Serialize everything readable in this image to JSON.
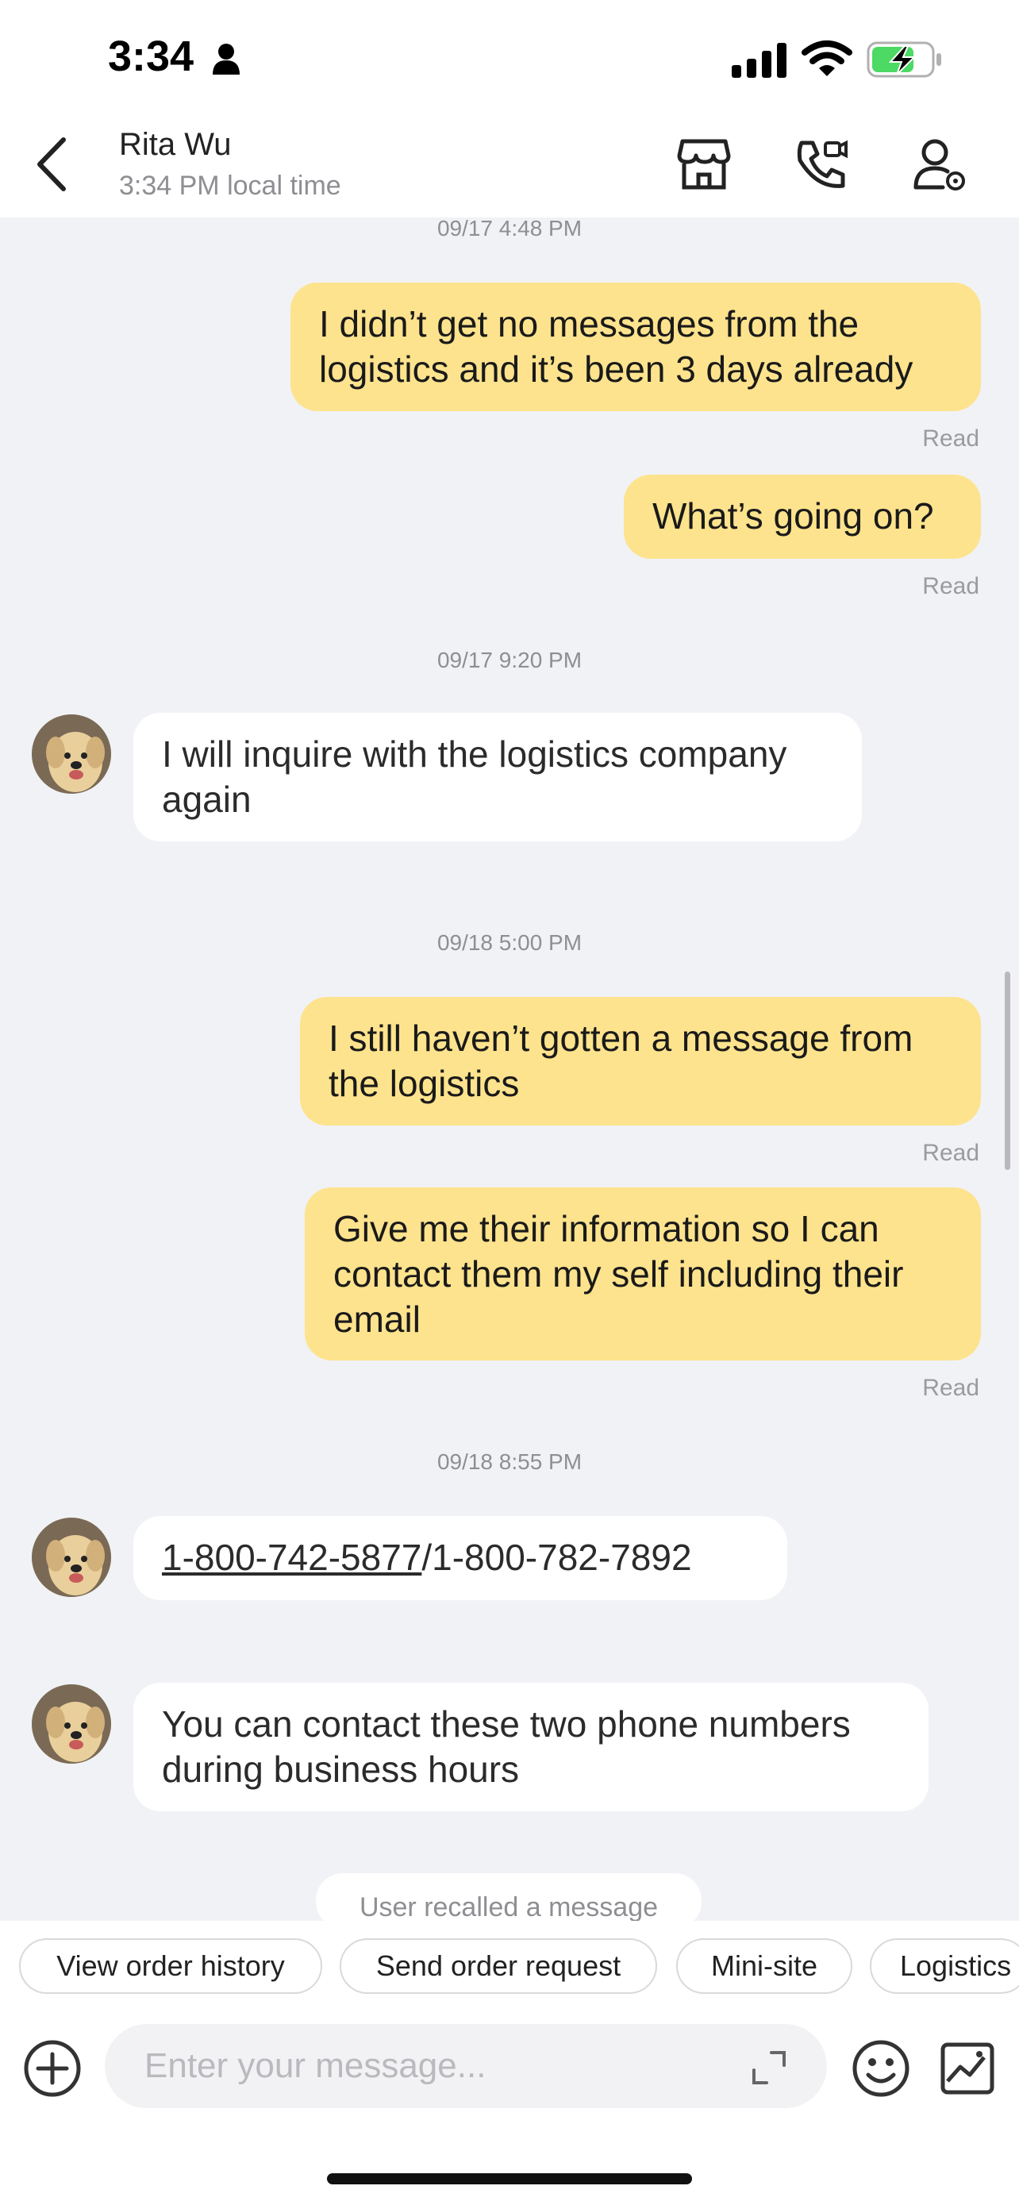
{
  "status": {
    "time": "3:34"
  },
  "header": {
    "name": "Rita Wu",
    "local_time": "3:34 PM local time"
  },
  "messages": {
    "ts1": "09/17 4:48 PM",
    "m1_line1": "I didn’t get no messages from the",
    "m1_line2": "logistics and it’s been 3 days already",
    "read1": "Read",
    "m2": "What’s going on?",
    "read2": "Read",
    "ts2": "09/17 9:20 PM",
    "m3_line1": "I will inquire with the logistics company",
    "m3_line2": "again",
    "ts3": "09/18 5:00 PM",
    "m4_line1": "I still haven’t gotten a message from",
    "m4_line2": "the logistics",
    "read3": "Read",
    "m5_line1": "Give me their information so I can",
    "m5_line2": "contact them my self including their",
    "m5_line3": "email",
    "read4": "Read",
    "ts4": "09/18 8:55 PM",
    "m6_link": "1-800-742-5877",
    "m6_rest": "/1-800-782-7892",
    "m7_line1": "You can contact these two phone numbers",
    "m7_line2": "during business hours",
    "recall": "User recalled a message"
  },
  "quick_actions": [
    "View order history",
    "Send order request",
    "Mini-site",
    "Logistics"
  ],
  "composer": {
    "placeholder": "Enter your message..."
  },
  "colors": {
    "outgoing_bubble": "#fde38d",
    "incoming_bubble": "#ffffff",
    "background": "#f1f2f6",
    "battery": "#4cd964"
  }
}
